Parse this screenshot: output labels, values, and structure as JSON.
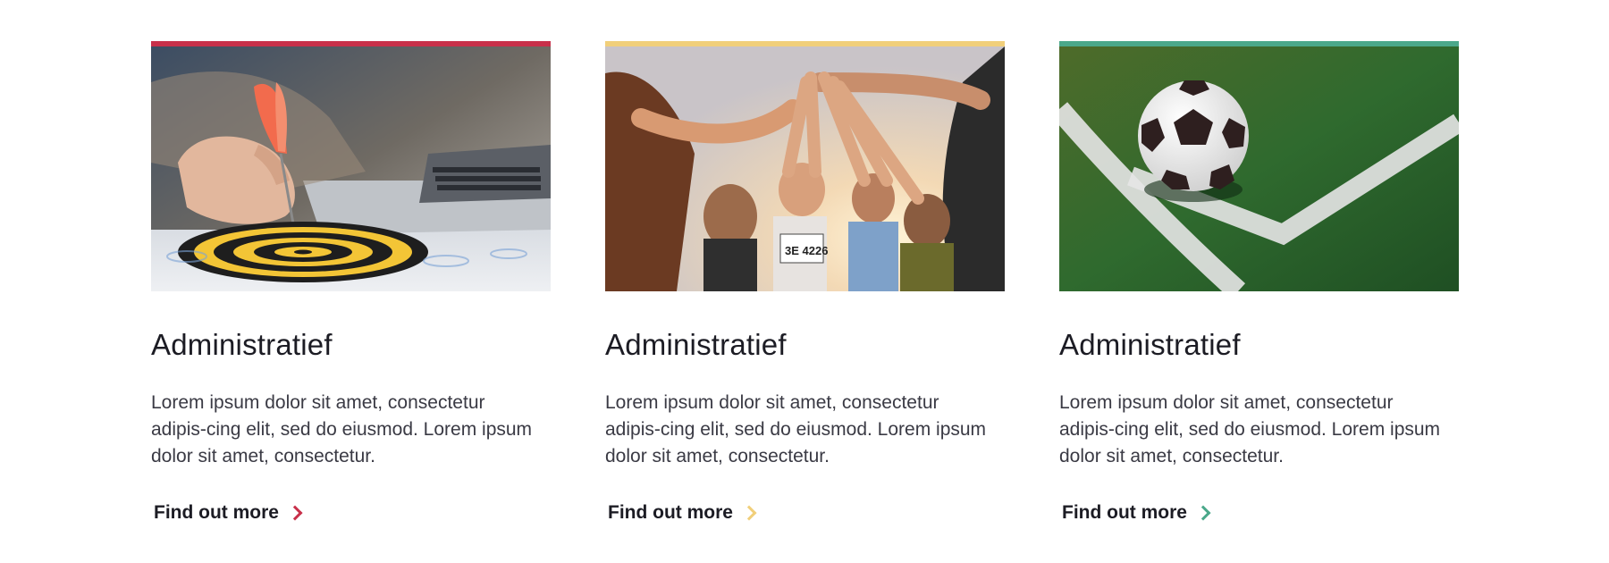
{
  "cards": [
    {
      "accent": "#c8304a",
      "image": "darts-target-laptop-photo",
      "title": "Administratief",
      "text": "Lorem ipsum dolor sit amet, consectetur adipis-cing elit, sed do eiusmod. Lorem ipsum dolor sit amet, consectetur.",
      "cta": "Find out more"
    },
    {
      "accent": "#f1cf7a",
      "image": "runners-high-five-photo",
      "title": "Administratief",
      "text": "Lorem ipsum dolor sit amet, consectetur adipis-cing elit, sed do eiusmod. Lorem ipsum dolor sit amet, consectetur.",
      "cta": "Find out more"
    },
    {
      "accent": "#4ba88a",
      "image": "soccer-ball-corner-photo",
      "title": "Administratief",
      "text": "Lorem ipsum dolor sit amet, consectetur adipis-cing elit, sed do eiusmod. Lorem ipsum dolor sit amet, consectetur.",
      "cta": "Find out more"
    }
  ]
}
